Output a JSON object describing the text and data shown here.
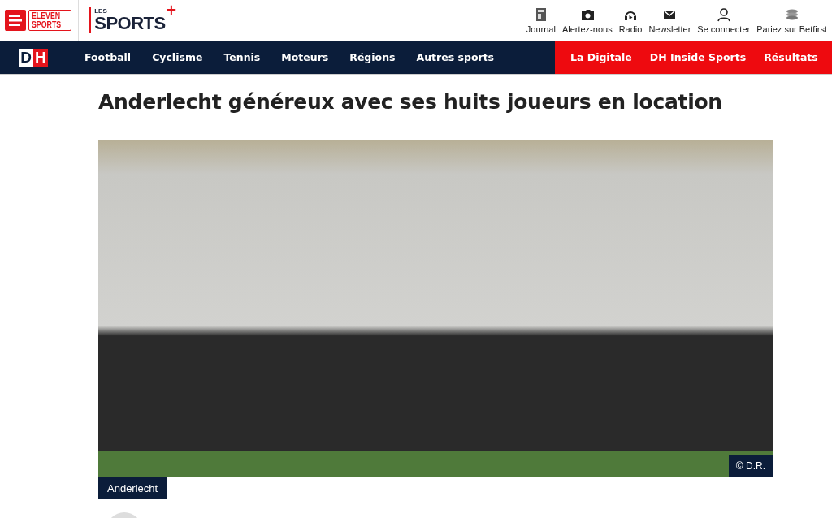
{
  "header": {
    "eleven_logo": {
      "line1": "ELEVEN",
      "line2": "SPORTS"
    },
    "sports_logo": {
      "small": "LES",
      "big": "SPORTS",
      "plus": "+"
    },
    "tools": [
      {
        "label": "Journal",
        "kind": "journal"
      },
      {
        "label": "Alertez-nous",
        "kind": "camera"
      },
      {
        "label": "Radio",
        "kind": "radio"
      },
      {
        "label": "Newsletter",
        "kind": "mail"
      },
      {
        "label": "Se connecter",
        "kind": "user"
      },
      {
        "label": "Pariez sur Betfirst",
        "kind": "chips"
      }
    ]
  },
  "nav": {
    "logo": {
      "left": "D",
      "right": "H"
    },
    "items": [
      {
        "label": "Football"
      },
      {
        "label": "Cyclisme"
      },
      {
        "label": "Tennis"
      },
      {
        "label": "Moteurs"
      },
      {
        "label": "Régions"
      },
      {
        "label": "Autres sports"
      }
    ],
    "highlight_items": [
      {
        "label": "La Digitale"
      },
      {
        "label": "DH Inside Sports"
      },
      {
        "label": "Résultats"
      }
    ]
  },
  "article": {
    "title": "Anderlecht généreux avec ses huits joueurs en location",
    "photo_credit": "© D.R.",
    "tag": "Anderlecht"
  }
}
